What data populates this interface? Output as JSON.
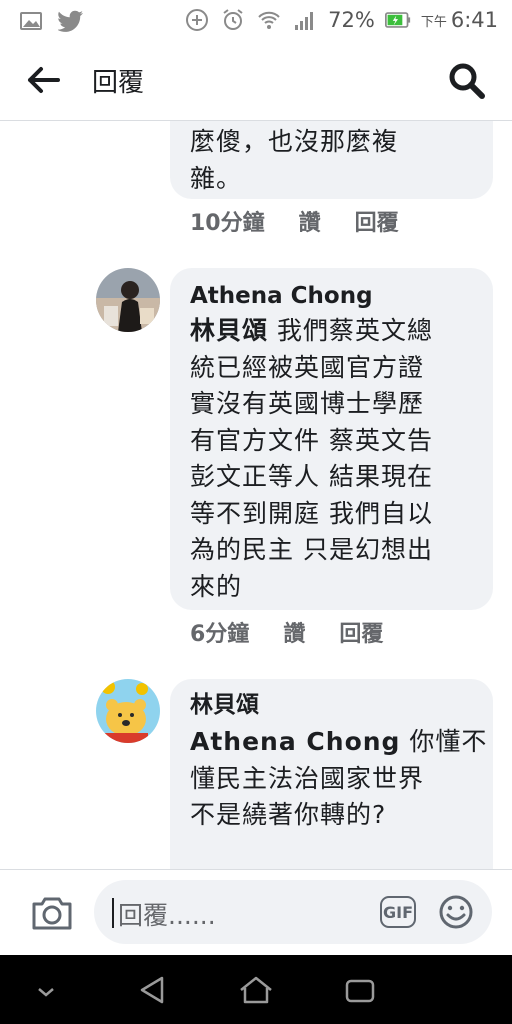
{
  "status_bar": {
    "battery_percent": "72%",
    "time_prefix": "下午",
    "time": "6:41",
    "icons": [
      "gallery-icon",
      "twitter-icon",
      "add-circle-icon",
      "alarm-icon",
      "wifi-icon",
      "signal-icon",
      "battery-icon"
    ]
  },
  "appbar": {
    "title": "回覆",
    "back_icon": "back-arrow-icon",
    "search_icon": "search-icon"
  },
  "comments": [
    {
      "author": "",
      "body_lines": [
        "麼傻，也沒那麼複",
        "雜。"
      ],
      "time": "10分鐘",
      "like_label": "讚",
      "reply_label": "回覆"
    },
    {
      "author": "Athena Chong",
      "tag": "林貝頌",
      "body_lines": [
        "我們蔡英文總",
        "統已經被英國官方證",
        "實沒有英國博士學歷",
        "有官方文件 蔡英文告",
        "彭文正等人 結果現在",
        "等不到開庭 我們自以",
        "為的民主 只是幻想出",
        "來的"
      ],
      "time": "6分鐘",
      "like_label": "讚",
      "reply_label": "回覆"
    },
    {
      "author": "林貝頌",
      "tag": "Athena Chong",
      "body_lines": [
        "你懂不",
        "懂民主法治國家世界",
        "不是繞著你轉的?"
      ]
    }
  ],
  "composer": {
    "placeholder": "回覆......",
    "gif_label": "GIF"
  },
  "colors": {
    "bubble_bg": "#f0f2f5",
    "text": "#1c1e21",
    "meta": "#65676b",
    "battery_green": "#3cbf3c"
  }
}
